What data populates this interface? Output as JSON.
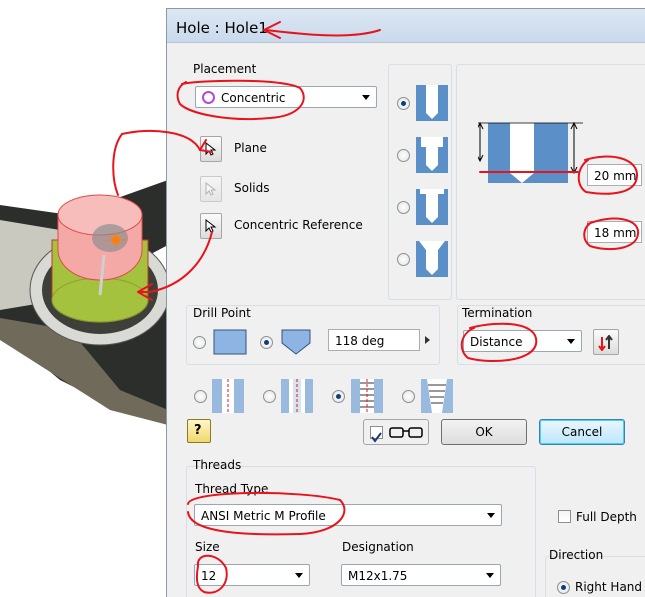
{
  "dialog": {
    "title": "Hole : Hole1"
  },
  "placement": {
    "label": "Placement",
    "type_value": "Concentric",
    "plane_label": "Plane",
    "solids_label": "Solids",
    "concentric_ref_label": "Concentric Reference"
  },
  "dimensions": {
    "depth_value": "20 mm",
    "hole_depth_value": "18 mm"
  },
  "drill_point": {
    "label": "Drill Point",
    "angle_value": "118 deg"
  },
  "termination": {
    "label": "Termination",
    "value": "Distance"
  },
  "buttons": {
    "ok_label": "OK",
    "cancel_label": "Cancel",
    "help_glyph": "?"
  },
  "threads": {
    "label": "Threads",
    "thread_type_label": "Thread Type",
    "thread_type_value": "ANSI Metric M Profile",
    "full_depth_label": "Full Depth",
    "size_label": "Size",
    "size_value": "12",
    "designation_label": "Designation",
    "designation_value": "M12x1.75",
    "direction_label": "Direction",
    "right_hand_label": "Right Hand"
  },
  "colors": {
    "annotation_red": "#e8141b",
    "accent_blue": "#3c7fb1",
    "model_green": "#a4c23d",
    "highlight_pink": "#f4a9a6"
  }
}
